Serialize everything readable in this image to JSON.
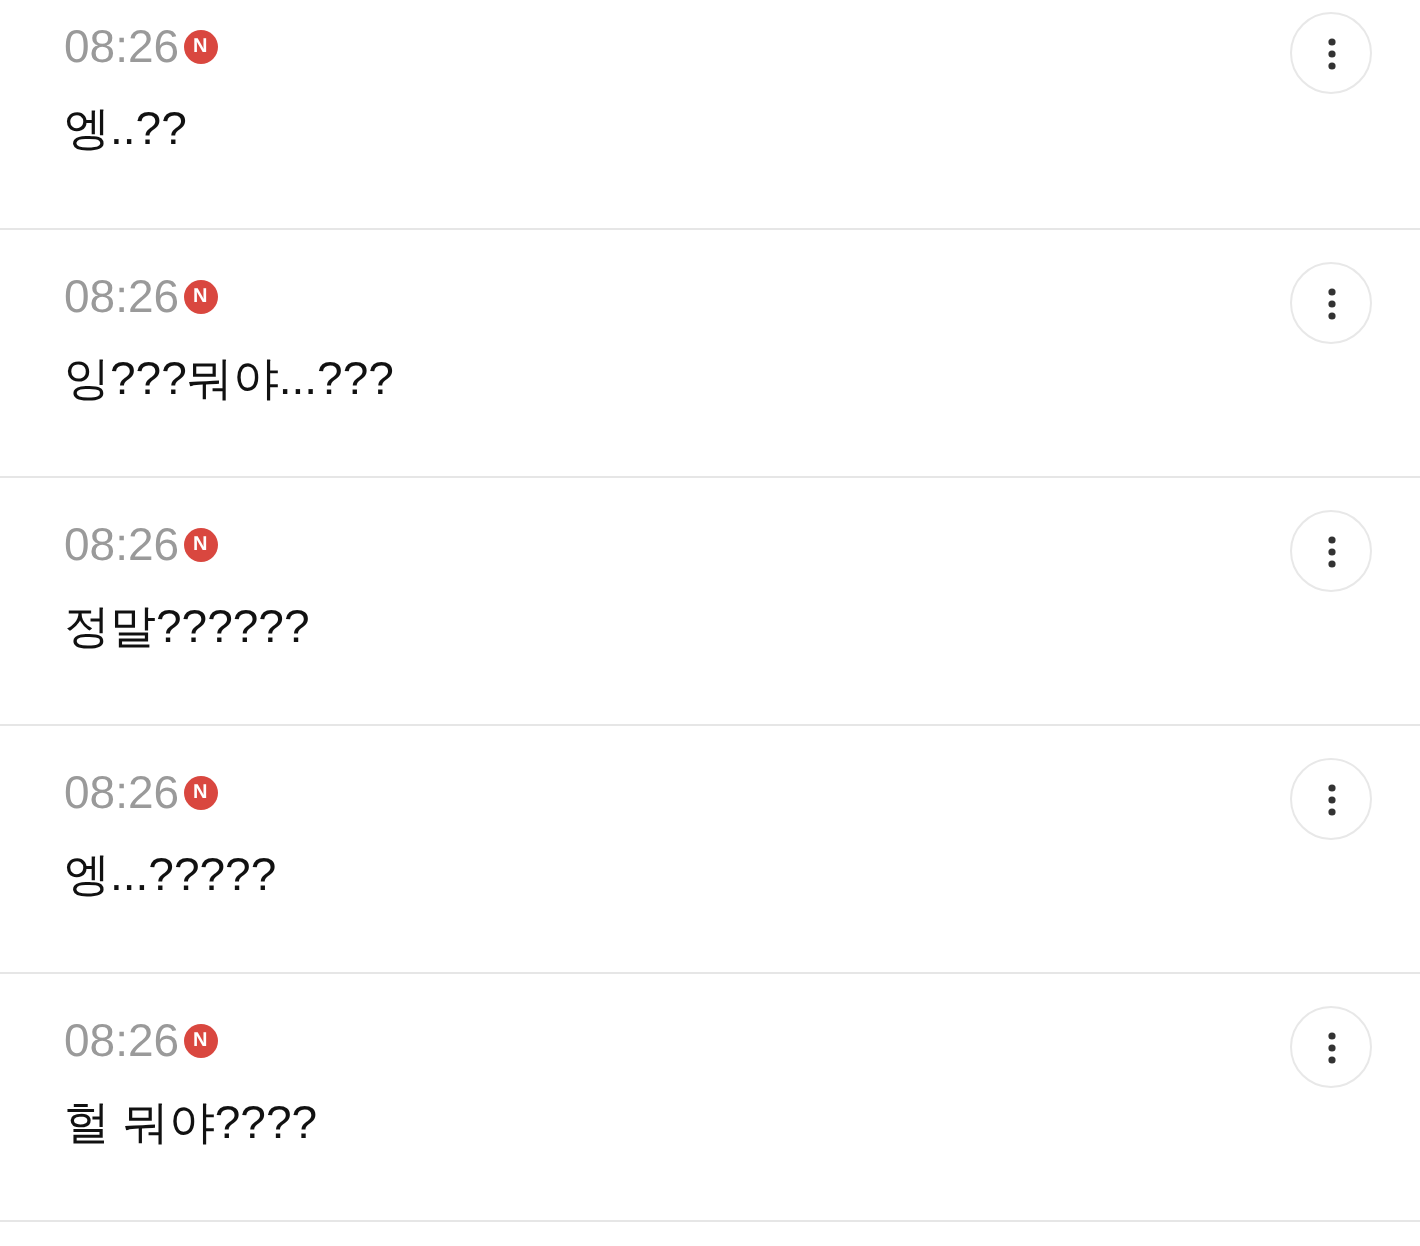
{
  "comments": [
    {
      "time": "08:26",
      "badge": "N",
      "text": "엥..??"
    },
    {
      "time": "08:26",
      "badge": "N",
      "text": "잉???뭐야...???"
    },
    {
      "time": "08:26",
      "badge": "N",
      "text": "정말??????"
    },
    {
      "time": "08:26",
      "badge": "N",
      "text": "엥...?????"
    },
    {
      "time": "08:26",
      "badge": "N",
      "text": "헐 뭐야????"
    }
  ]
}
